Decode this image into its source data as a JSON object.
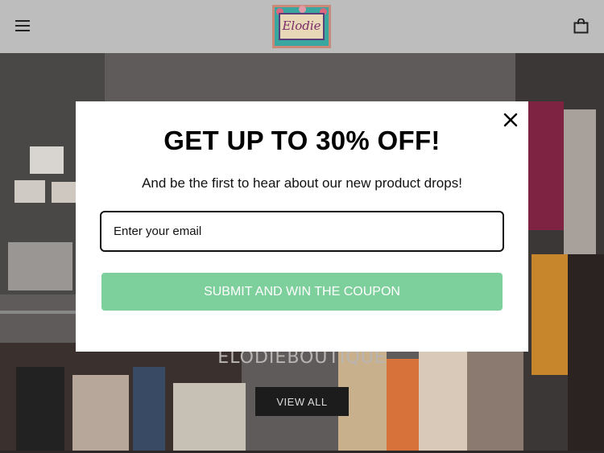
{
  "header": {
    "menu_icon": "hamburger-menu-icon",
    "logo_text": "Elodie",
    "cart_icon": "shopping-bag-icon"
  },
  "hero": {
    "title": "ELODIEBOUTIQUE",
    "button_label": "VIEW ALL"
  },
  "popup": {
    "title": "GET UP TO 30% OFF!",
    "subtitle": "And be the first to hear about our new product drops!",
    "email_placeholder": "Enter your email",
    "submit_label": "SUBMIT AND WIN THE COUPON",
    "close_icon": "close-icon",
    "submit_color": "#7dcf9b"
  }
}
